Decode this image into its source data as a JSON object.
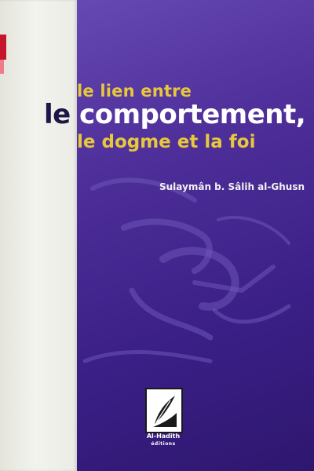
{
  "cover": {
    "title_line1": "le lien entre",
    "title_line2_first": "le",
    "title_line2_rest": " comportement,",
    "title_line3": "le dogme et la foi",
    "author": "Sulaymân b. Sâlih al-Ghusn"
  },
  "publisher": {
    "name": "Al-Hadith",
    "sub": "éditions",
    "icon": "quill-logo-icon"
  },
  "colors": {
    "background": "#4f2f9a",
    "title_accent": "#e7c83c",
    "title_main": "#ffffff",
    "spine": "#ecece6",
    "spine_tab": "#c5152b"
  }
}
